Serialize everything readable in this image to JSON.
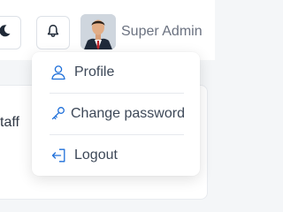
{
  "header": {
    "theme_toggle_icon": "moon-icon",
    "notifications_icon": "bell-icon",
    "user": {
      "name": "Super Admin",
      "avatar_icon": "user-avatar"
    }
  },
  "background": {
    "partial_text": "taff"
  },
  "user_menu": {
    "items": [
      {
        "label": "Profile",
        "icon": "user-icon"
      },
      {
        "label": "Change password",
        "icon": "key-icon"
      },
      {
        "label": "Logout",
        "icon": "logout-icon"
      }
    ]
  },
  "colors": {
    "accent": "#1e6fd9",
    "text": "#3d4858",
    "muted": "#6b7280"
  }
}
